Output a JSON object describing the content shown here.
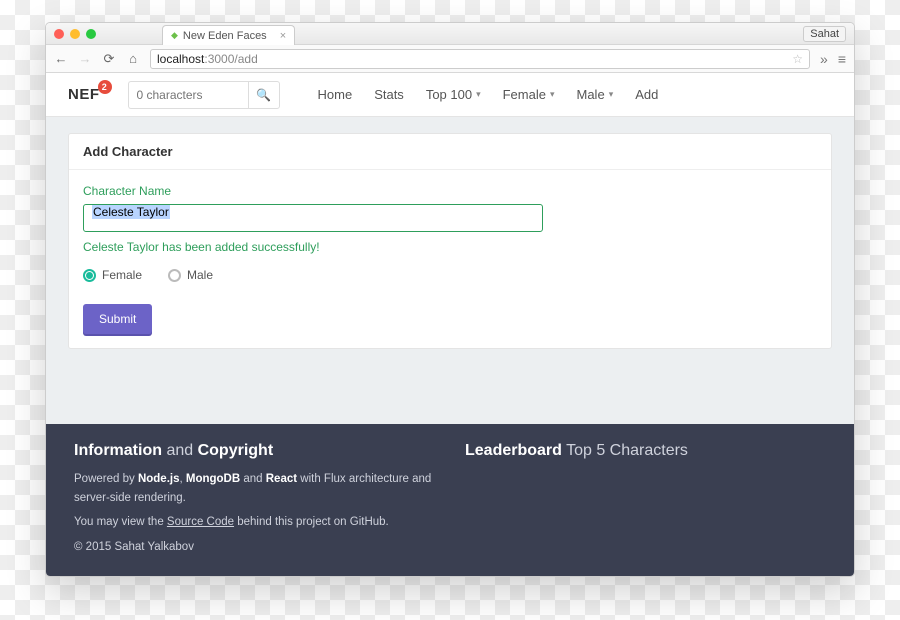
{
  "browser": {
    "tab_title": "New Eden Faces",
    "user_button": "Sahat",
    "url_host": "localhost",
    "url_port": ":3000",
    "url_path": "/add"
  },
  "navbar": {
    "brand": "NEF",
    "badge": "2",
    "search_placeholder": "0 characters",
    "links": {
      "home": "Home",
      "stats": "Stats",
      "top100": "Top 100",
      "female": "Female",
      "male": "Male",
      "add": "Add"
    }
  },
  "form": {
    "panel_title": "Add Character",
    "label": "Character Name",
    "value": "Celeste Taylor",
    "success_msg": "Celeste Taylor has been added successfully!",
    "gender": {
      "female": "Female",
      "male": "Male",
      "selected": "female"
    },
    "submit": "Submit"
  },
  "footer": {
    "info_title_a": "Information",
    "info_title_mid": " and ",
    "info_title_b": "Copyright",
    "lb_title_a": "Leaderboard",
    "lb_title_b": " Top 5 Characters",
    "p1_a": "Powered by ",
    "p1_node": "Node.js",
    "p1_sep1": ", ",
    "p1_mongo": "MongoDB",
    "p1_sep2": " and ",
    "p1_react": "React",
    "p1_b": " with Flux architecture and server-side rendering.",
    "p2_a": "You may view the ",
    "p2_link": "Source Code",
    "p2_b": " behind this project on GitHub.",
    "copyright": "© 2015 Sahat Yalkabov"
  }
}
